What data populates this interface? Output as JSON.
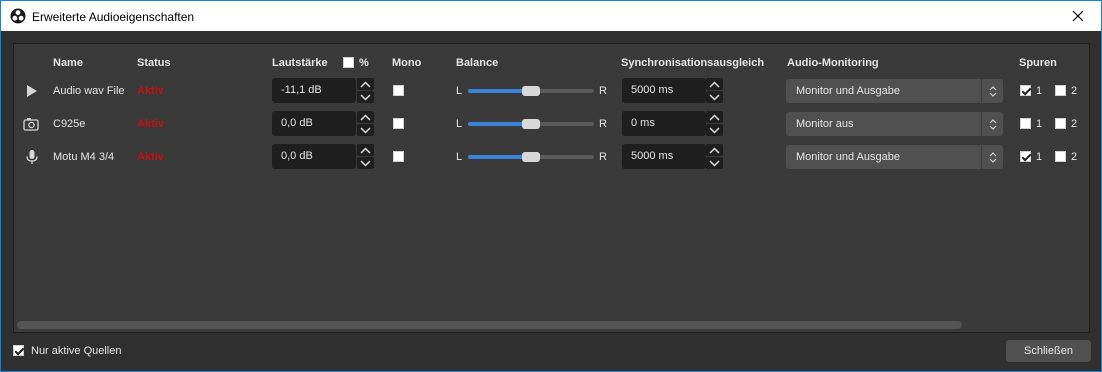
{
  "window": {
    "title": "Erweiterte Audioeigenschaften",
    "close_icon": "close-icon",
    "app_icon": "obs-logo-icon"
  },
  "columns": {
    "name": "Name",
    "status": "Status",
    "volume": "Lautstärke",
    "volume_percent": "%",
    "mono": "Mono",
    "balance": "Balance",
    "sync": "Synchronisationsausgleich",
    "monitoring": "Audio-Monitoring",
    "tracks": "Spuren"
  },
  "rows": [
    {
      "icon": "play-icon",
      "name": "Audio wav File",
      "status": "Aktiv",
      "volume": "-11,1 dB",
      "mono": false,
      "balance_left": "L",
      "balance_right": "R",
      "balance": 0.5,
      "sync": "5000 ms",
      "monitoring": "Monitor und Ausgabe",
      "track1_label": "1",
      "track1": true,
      "track2_label": "2",
      "track2": false
    },
    {
      "icon": "camera-icon",
      "name": "C925e",
      "status": "Aktiv",
      "volume": "0,0 dB",
      "mono": false,
      "balance_left": "L",
      "balance_right": "R",
      "balance": 0.5,
      "sync": "0 ms",
      "monitoring": "Monitor aus",
      "track1_label": "1",
      "track1": false,
      "track2_label": "2",
      "track2": false
    },
    {
      "icon": "microphone-icon",
      "name": "Motu M4 3/4",
      "status": "Aktiv",
      "volume": "0,0 dB",
      "mono": false,
      "balance_left": "L",
      "balance_right": "R",
      "balance": 0.5,
      "sync": "5000 ms",
      "monitoring": "Monitor und Ausgabe",
      "track1_label": "1",
      "track1": true,
      "track2_label": "2",
      "track2": false
    }
  ],
  "footer": {
    "only_active_label": "Nur aktive Quellen",
    "only_active": true,
    "close_button": "Schließen"
  },
  "colors": {
    "status_active": "#c31212",
    "accent": "#3a83d6",
    "background": "#303030"
  }
}
